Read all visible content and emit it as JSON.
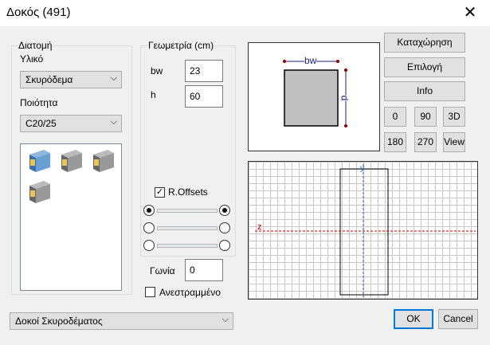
{
  "window": {
    "title": "Δοκός (491)",
    "close_glyph": "✕"
  },
  "section": {
    "label": "Διατομή",
    "material_label": "Υλικό",
    "material_value": "Σκυρόδεμα",
    "quality_label": "Ποιότητα",
    "quality_value": "C20/25"
  },
  "geometry": {
    "label": "Γεωμετρία (cm)",
    "bw_label": "bw",
    "bw_value": "23",
    "h_label": "h",
    "h_value": "60",
    "roffsets_label": "R.Offsets",
    "roffsets_checked": true,
    "angle_label": "Γωνία",
    "angle_value": "0",
    "inverted_label": "Ανεστραμμένο",
    "inverted_checked": false
  },
  "preview": {
    "width_dim": "bw",
    "height_dim": "d",
    "z_axis": "z",
    "y_axis": "y"
  },
  "buttons": {
    "register": "Καταχώρηση",
    "select": "Επιλογή",
    "info": "Info",
    "v0": "0",
    "v90": "90",
    "v3d": "3D",
    "v180": "180",
    "v270": "270",
    "view": "View",
    "ok": "OK",
    "cancel": "Cancel"
  },
  "family_combo": "Δοκοί Σκυροδέματος",
  "colors": {
    "accent": "#0078d7",
    "concrete": "#c0c0c0",
    "dim_arrow": "#8b0000",
    "axis_red": "#d00000",
    "axis_blue": "#3060d0"
  }
}
